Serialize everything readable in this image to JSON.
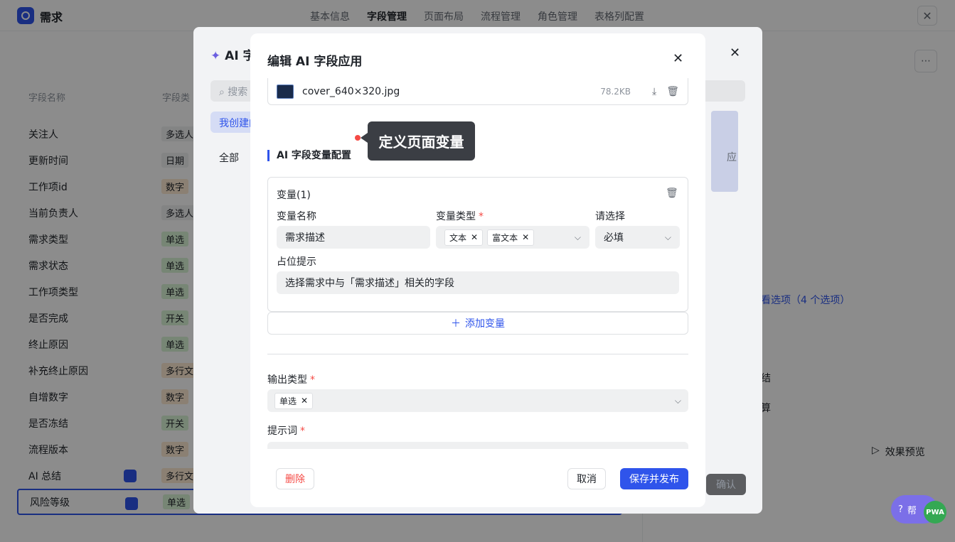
{
  "app": {
    "title": "需求"
  },
  "top_nav": [
    "基本信息",
    "字段管理",
    "页面布局",
    "流程管理",
    "角色管理",
    "表格列配置"
  ],
  "table": {
    "headers": [
      "字段名称",
      "字段类"
    ],
    "rows": [
      {
        "name": "关注人",
        "type": "多选人",
        "color": "gray"
      },
      {
        "name": "更新时间",
        "type": "日期",
        "color": "gray"
      },
      {
        "name": "工作项id",
        "type": "数字",
        "color": "orange"
      },
      {
        "name": "当前负责人",
        "type": "多选人",
        "color": "gray"
      },
      {
        "name": "需求类型",
        "type": "单选",
        "color": "green"
      },
      {
        "name": "需求状态",
        "type": "单选",
        "color": "green"
      },
      {
        "name": "工作项类型",
        "type": "单选",
        "color": "green"
      },
      {
        "name": "是否完成",
        "type": "开关",
        "color": "green"
      },
      {
        "name": "终止原因",
        "type": "单选",
        "color": "green"
      },
      {
        "name": "补充终止原因",
        "type": "多行文",
        "color": "orange"
      },
      {
        "name": "自增数字",
        "type": "数字",
        "color": "orange"
      },
      {
        "name": "是否冻结",
        "type": "开关",
        "color": "green"
      },
      {
        "name": "流程版本",
        "type": "数字",
        "color": "orange"
      },
      {
        "name": "AI 总结",
        "type": "多行文",
        "color": "orange"
      },
      {
        "name": "风险等级",
        "type": "单选",
        "color": "green"
      }
    ]
  },
  "right_panel": {
    "options_link": "看选项（4 个选项）",
    "field1": "结",
    "field2": "算",
    "preview": "效果预览",
    "confirm": "确认"
  },
  "modal1": {
    "title": "AI 字",
    "search_placeholder": "搜索",
    "tab_active": "我创建的",
    "tab_all": "全部",
    "card_text": "应"
  },
  "modal2": {
    "title": "编辑 AI 字段应用",
    "file": {
      "name": "cover_640×320.jpg",
      "size": "78.2KB"
    },
    "section_title": "AI 字段变量配置",
    "variable": {
      "header": "变量(1)",
      "name_label": "变量名称",
      "name_value": "需求描述",
      "type_label": "变量类型",
      "type_chips": [
        "文本",
        "富文本"
      ],
      "required_label": "请选择",
      "required_value": "必填",
      "placeholder_label": "占位提示",
      "placeholder_value": "选择需求中与「需求描述」相关的字段"
    },
    "add_variable": "添加变量",
    "output_type_label": "输出类型",
    "output_type_chip": "单选",
    "prompt_label": "提示词",
    "buttons": {
      "delete": "删除",
      "cancel": "取消",
      "save": "保存并发布"
    }
  },
  "tooltip": "定义页面变量",
  "help": {
    "label": "帮",
    "pwa": "PWA"
  }
}
